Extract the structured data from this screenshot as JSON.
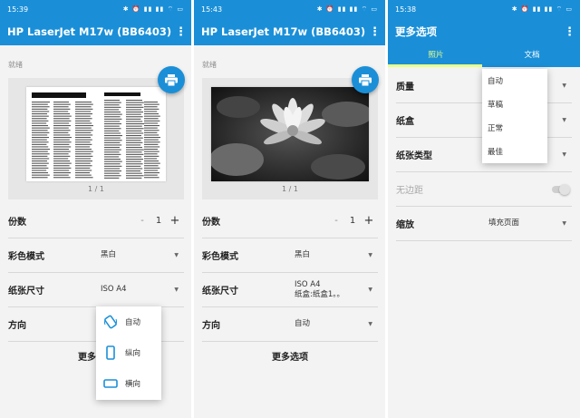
{
  "panels": [
    {
      "status_time": "15:39",
      "status_icons": "✱ ⏰ ▮▮ ▮▮ ⌔ ▭",
      "title": "HP LaserJet M17w (BB6403)",
      "printer_state": "就绪",
      "page_count": "1 / 1",
      "copies_label": "份数",
      "copies_minus": "-",
      "copies_value": "1",
      "copies_plus": "+",
      "color_label": "彩色模式",
      "color_value": "黑白",
      "paper_label": "纸张尺寸",
      "paper_value": "ISO A4",
      "orientation_label": "方向",
      "more_options": "更多选项",
      "orientation_menu": [
        {
          "label": "自动",
          "icon": "auto-rotate-icon"
        },
        {
          "label": "纵向",
          "icon": "portrait-icon"
        },
        {
          "label": "横向",
          "icon": "landscape-icon"
        }
      ]
    },
    {
      "status_time": "15:43",
      "status_icons": "✱ ⏰ ▮▮ ▮▮ ⌔ ▭",
      "title": "HP LaserJet M17w (BB6403)",
      "printer_state": "就绪",
      "page_count": "1 / 1",
      "copies_label": "份数",
      "copies_minus": "-",
      "copies_value": "1",
      "copies_plus": "+",
      "color_label": "彩色模式",
      "color_value": "黑白",
      "paper_label": "纸张尺寸",
      "paper_value_line1": "ISO A4",
      "paper_value_line2": "纸盒:纸盒1。。",
      "orientation_label": "方向",
      "orientation_value": "自动",
      "more_options": "更多选项"
    },
    {
      "status_time": "15:38",
      "status_icons": "✱ ⏰ ▮▮ ▮▮ ⌔ ▭",
      "title": "更多选项",
      "tabs": [
        "照片",
        "文档"
      ],
      "quality_label": "质量",
      "tray_label": "纸盒",
      "paper_type_label": "纸张类型",
      "borderless_label": "无边距",
      "scale_label": "缩放",
      "scale_value": "填充页面",
      "quality_menu": [
        "自动",
        "草稿",
        "正常",
        "最佳"
      ]
    }
  ],
  "colors": {
    "primary": "#1a8fd8",
    "tab_active": "#e8ff8a"
  }
}
